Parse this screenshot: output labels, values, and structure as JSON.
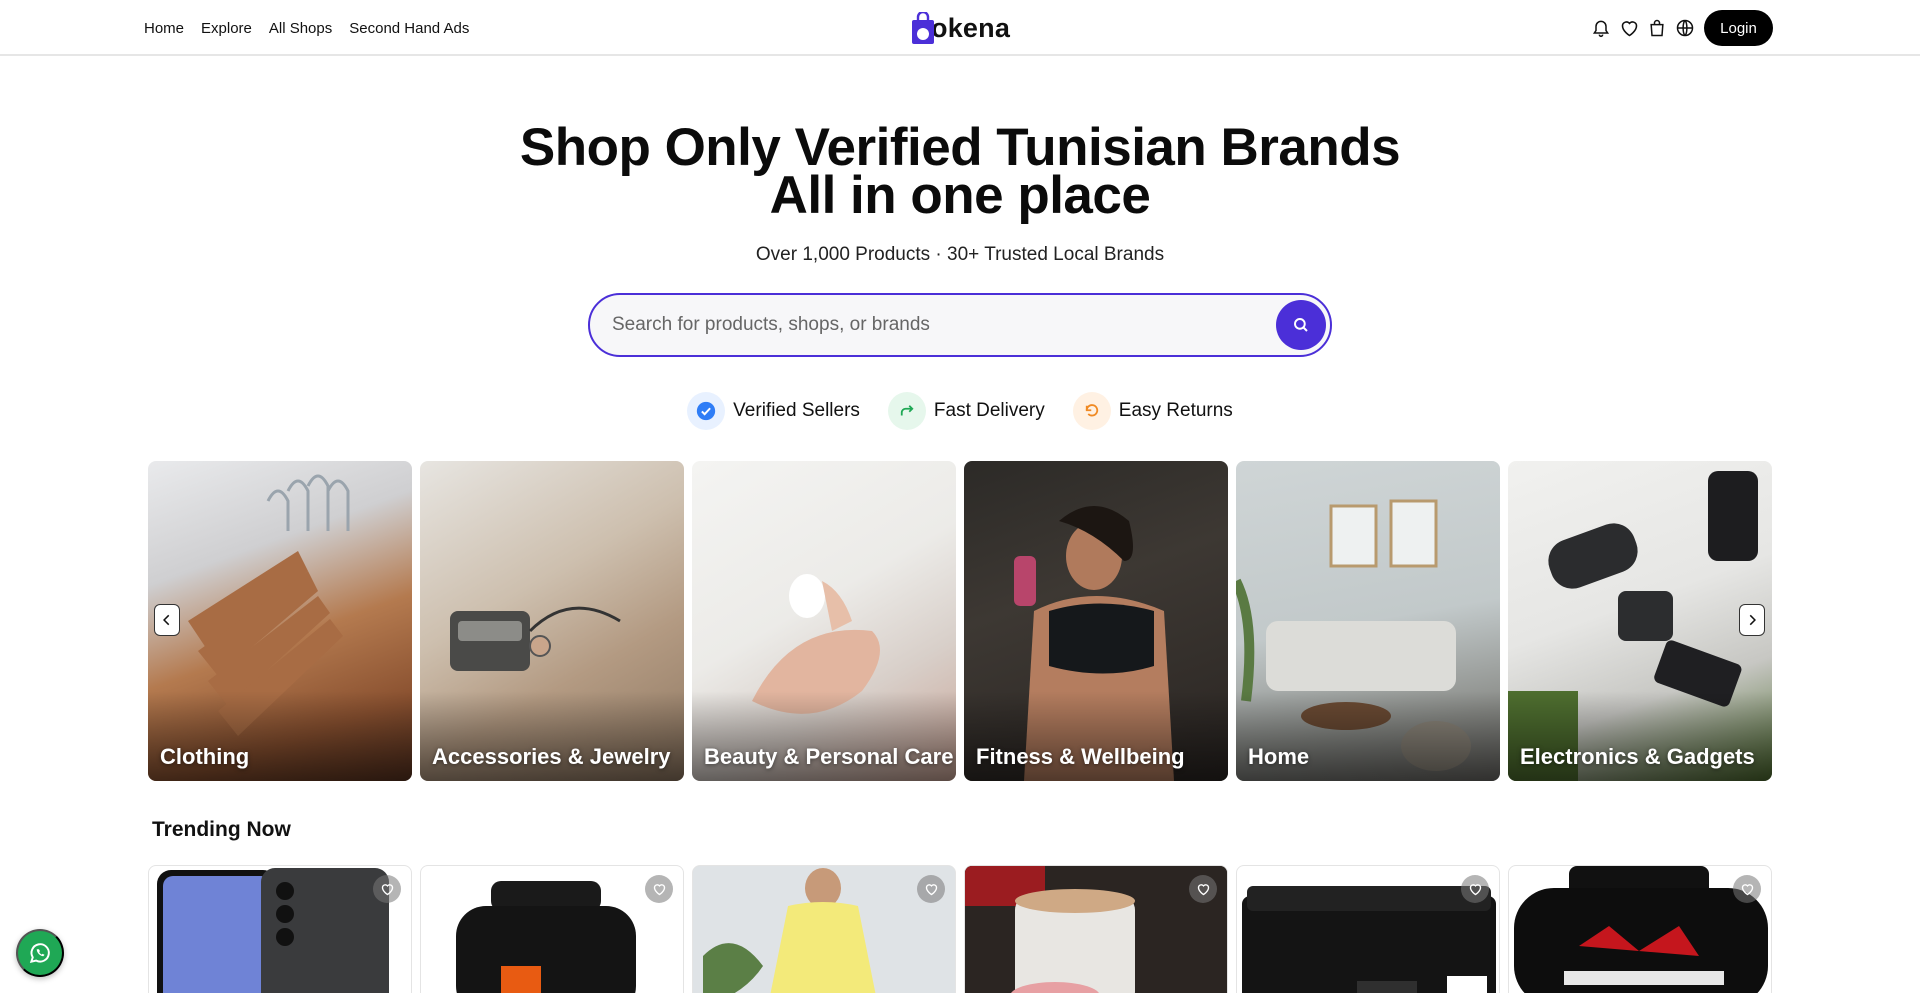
{
  "nav": {
    "items": [
      {
        "label": "Home"
      },
      {
        "label": "Explore"
      },
      {
        "label": "All Shops"
      },
      {
        "label": "Second Hand Ads"
      }
    ]
  },
  "brand": {
    "name": "okena",
    "accent": "#4b2fd8"
  },
  "header": {
    "login_label": "Login",
    "icons": [
      "bell-icon",
      "heart-icon",
      "shopping-bag-icon",
      "globe-icon"
    ]
  },
  "hero": {
    "title_line1": "Shop Only Verified Tunisian Brands",
    "title_line2": "All in one place",
    "subtitle": "Over 1,000 Products · 30+ Trusted Local Brands"
  },
  "search": {
    "placeholder": "Search for products, shops, or brands",
    "value": ""
  },
  "features": [
    {
      "label": "Verified Sellers",
      "icon": "check-badge-icon",
      "color": "#2f7df6"
    },
    {
      "label": "Fast Delivery",
      "icon": "forward-arrow-icon",
      "color": "#1fa855"
    },
    {
      "label": "Easy Returns",
      "icon": "return-icon",
      "color": "#f08a24"
    }
  ],
  "categories": [
    {
      "label": "Clothing"
    },
    {
      "label": "Accessories & Jewelry"
    },
    {
      "label": "Beauty & Personal Care"
    },
    {
      "label": "Fitness & Wellbeing"
    },
    {
      "label": "Home"
    },
    {
      "label": "Electronics & Gadgets"
    }
  ],
  "trending": {
    "title": "Trending Now",
    "product_count": 6
  }
}
